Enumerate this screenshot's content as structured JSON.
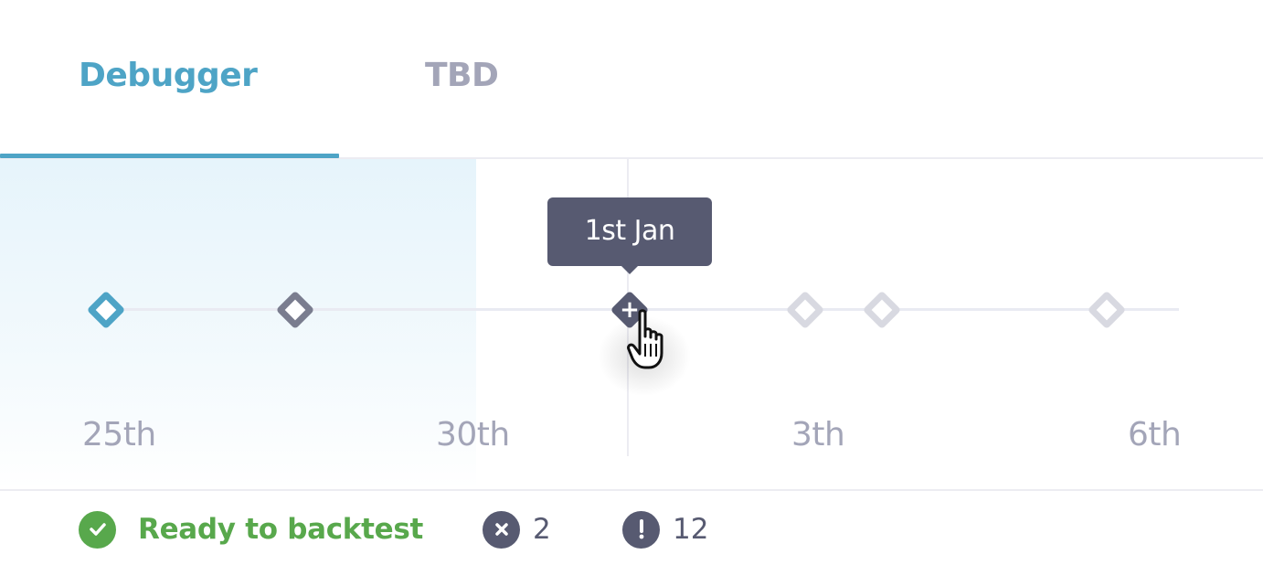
{
  "tabs": [
    {
      "label": "Debugger",
      "active": true
    },
    {
      "label": "TBD",
      "active": false
    }
  ],
  "timeline": {
    "tooltip": "1st Jan",
    "tick_labels": [
      "25th",
      "30th",
      "3th",
      "6th"
    ],
    "markers": [
      {
        "state": "active"
      },
      {
        "state": "visited"
      },
      {
        "state": "selected"
      },
      {
        "state": "inactive"
      },
      {
        "state": "inactive"
      },
      {
        "state": "inactive"
      }
    ]
  },
  "status": {
    "ready_label": "Ready to backtest",
    "ready_icon": "check-circle-icon",
    "errors_icon": "x-circle-icon",
    "errors_count": "2",
    "warnings_icon": "exclamation-circle-icon",
    "warnings_count": "12"
  },
  "colors": {
    "accent": "#4ea4c6",
    "success": "#58a84c",
    "dark": "#575a71",
    "muted": "#a3a5b8"
  }
}
